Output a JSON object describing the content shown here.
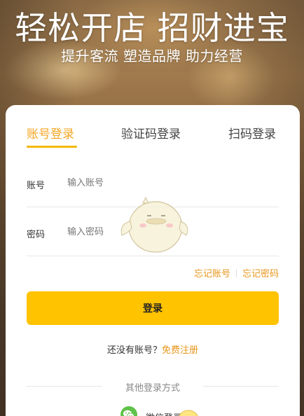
{
  "hero": {
    "headline": "轻松开店  招财进宝",
    "subline": "提升客流 塑造品牌 助力经营"
  },
  "tabs": [
    {
      "label": "账号登录",
      "active": true
    },
    {
      "label": "验证码登录",
      "active": false
    },
    {
      "label": "扫码登录",
      "active": false
    }
  ],
  "form": {
    "account": {
      "label": "账号",
      "placeholder": "输入账号",
      "value": ""
    },
    "password": {
      "label": "密码",
      "placeholder": "输入密码",
      "value": ""
    }
  },
  "forgot": {
    "account_label": "忘记账号",
    "password_label": "忘记密码"
  },
  "login_button": "登录",
  "register": {
    "prompt": "还没有账号？",
    "link": "免费注册"
  },
  "other_login": {
    "title": "其他登录方式",
    "wechat_label": "微信登录"
  },
  "colors": {
    "accent": "#f5a623",
    "button": "#ffc300",
    "link": "#e8951a",
    "wechat": "#5fc24a"
  },
  "icons": {
    "mascot": "chick-mascot-icon",
    "wechat": "wechat-icon"
  }
}
